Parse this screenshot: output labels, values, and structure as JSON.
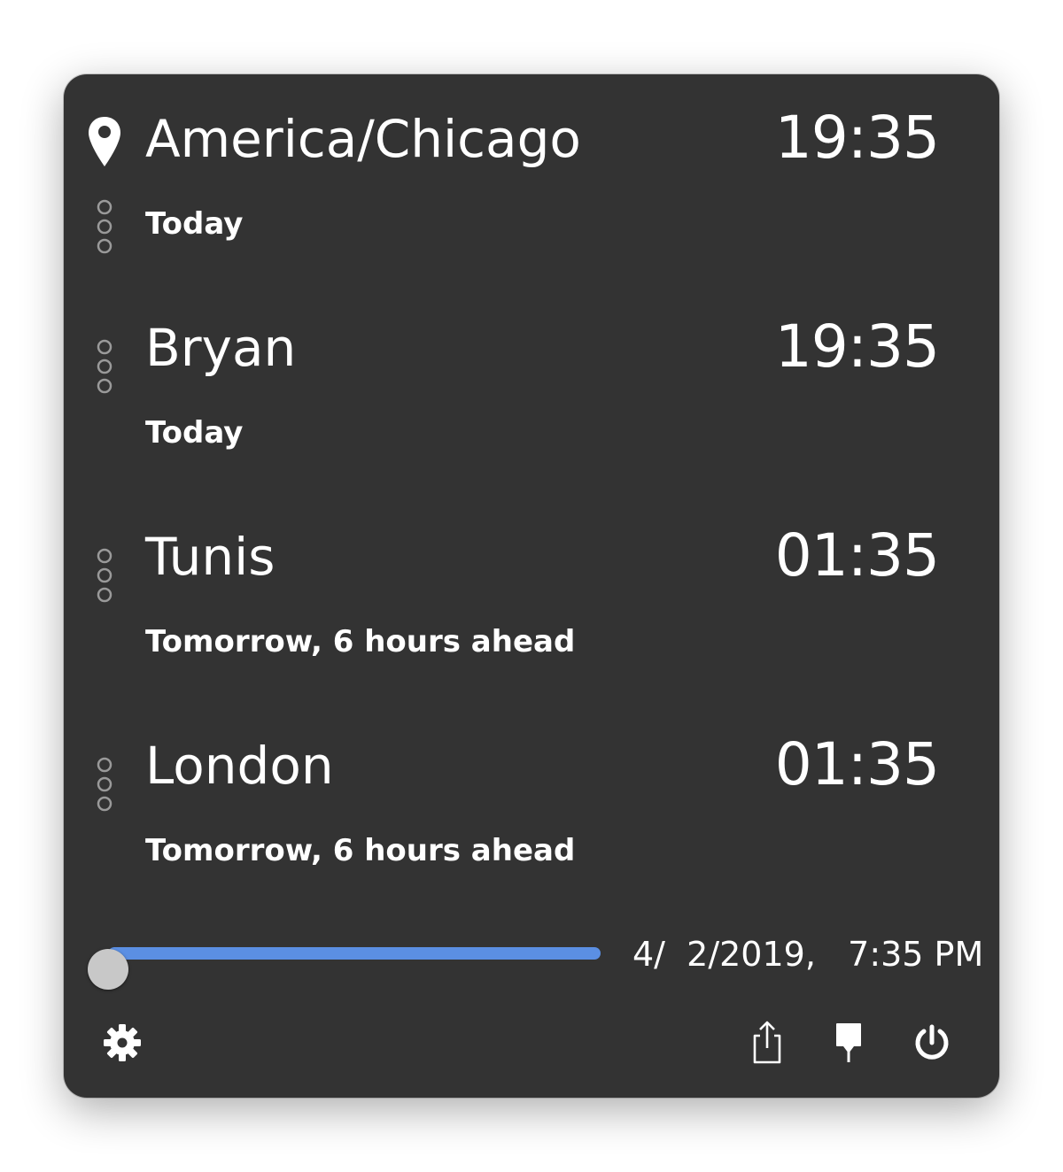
{
  "clocks": [
    {
      "name": "America/Chicago",
      "time": "19:35",
      "subtitle": "Today",
      "icon": "map-pin-icon"
    },
    {
      "name": "Bryan",
      "time": "19:35",
      "subtitle": "Today",
      "icon": "drag-handle-icon"
    },
    {
      "name": "Tunis",
      "time": "01:35",
      "subtitle": "Tomorrow, 6 hours ahead",
      "icon": "drag-handle-icon"
    },
    {
      "name": "London",
      "time": "01:35",
      "subtitle": "Tomorrow, 6 hours ahead",
      "icon": "drag-handle-icon"
    }
  ],
  "time_slider": {
    "value": 0.0,
    "datetime_label": "4/  2/2019,   7:35 PM"
  },
  "toolbar": {
    "settings_icon": "gear-icon",
    "share_icon": "share-icon",
    "pin_icon": "pin-icon",
    "quit_icon": "power-icon"
  },
  "colors": {
    "panel_background": "#333333",
    "text": "#ffffff",
    "slider_accent": "#5b8fe3",
    "slider_thumb": "#c8c8c8",
    "icon_muted": "#9a9a9a"
  }
}
